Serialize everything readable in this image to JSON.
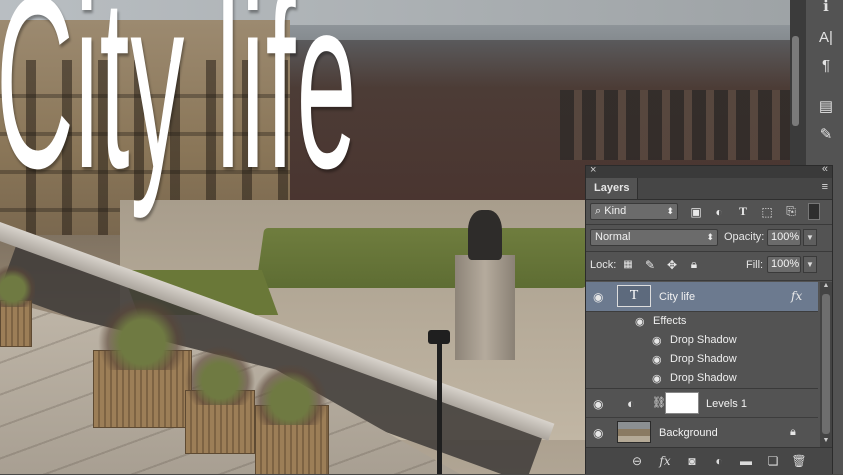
{
  "canvas": {
    "title_text": "City life"
  },
  "tool_strip": {
    "tools": [
      {
        "icon": "info-icon",
        "glyph": "ℹ"
      },
      {
        "icon": "character-icon",
        "glyph": "A|"
      },
      {
        "icon": "paragraph-icon",
        "glyph": "¶"
      },
      {
        "icon": "glyphs-icon",
        "glyph": "▤"
      },
      {
        "icon": "notes-icon",
        "glyph": "✎"
      }
    ]
  },
  "layers_panel": {
    "close_glyph": "×",
    "collapse_glyph": "«",
    "tab_label": "Layers",
    "menu_glyph": "≡",
    "filter": {
      "kind_label": "Kind",
      "search_glyph": "⌕"
    },
    "blend_mode": "Normal",
    "opacity_label": "Opacity:",
    "opacity_value": "100%",
    "lock_label": "Lock:",
    "fill_label": "Fill:",
    "fill_value": "100%",
    "layers": [
      {
        "name": "City life",
        "type": "text",
        "thumb_glyph": "T",
        "fx": "fx",
        "selected": true,
        "effects_label": "Effects",
        "effects": [
          "Drop Shadow",
          "Drop Shadow",
          "Drop Shadow"
        ]
      },
      {
        "name": "Levels 1",
        "type": "adjustment"
      },
      {
        "name": "Background",
        "type": "image",
        "locked": true
      }
    ],
    "footer_fx": "fx"
  },
  "colors": {
    "panel_bg": "#535353",
    "selected_row": "#6c7a8f",
    "title_text": "#ffffff"
  }
}
